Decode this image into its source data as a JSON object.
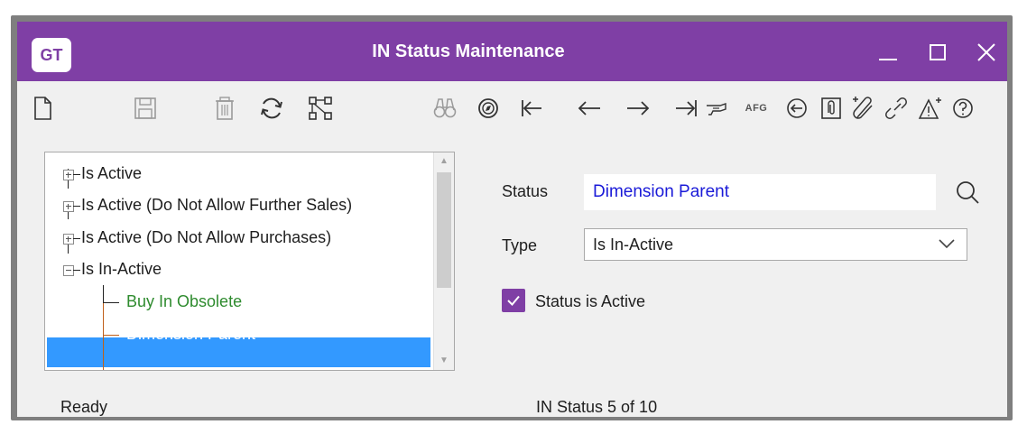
{
  "window": {
    "logo": "GT",
    "title": "IN Status Maintenance"
  },
  "toolbar": {
    "afg_label": "AFG"
  },
  "tree": {
    "items": [
      {
        "label": "Is Active"
      },
      {
        "label": "Is Active (Do Not Allow Further Sales)"
      },
      {
        "label": "Is Active (Do Not Allow Purchases)"
      },
      {
        "label": "Is In-Active"
      },
      {
        "label": "Buy In Obsolete"
      },
      {
        "label": "Dimension Parent"
      }
    ]
  },
  "form": {
    "status_label": "Status",
    "status_value": "Dimension Parent",
    "type_label": "Type",
    "type_value": "Is In-Active",
    "active_checkbox_label": "Status is Active",
    "active_checked": true
  },
  "statusbar": {
    "state": "Ready",
    "position": "IN Status 5 of 10"
  },
  "colors": {
    "titlebar": "#7f3fa5",
    "selection": "#3399ff",
    "child_green": "#2e8b2e",
    "link_blue": "#1a1ad8"
  }
}
